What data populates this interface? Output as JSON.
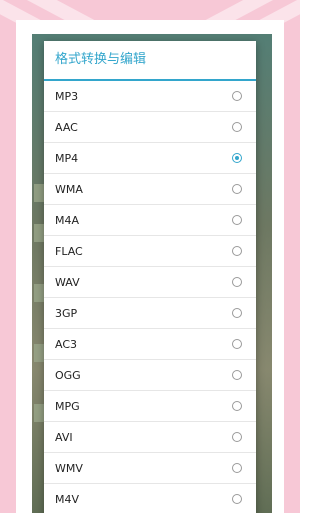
{
  "dialog": {
    "title": "格式转换与编辑",
    "selected": "MP4",
    "options": [
      {
        "label": "MP3",
        "checked": false
      },
      {
        "label": "AAC",
        "checked": false
      },
      {
        "label": "MP4",
        "checked": true
      },
      {
        "label": "WMA",
        "checked": false
      },
      {
        "label": "M4A",
        "checked": false
      },
      {
        "label": "FLAC",
        "checked": false
      },
      {
        "label": "WAV",
        "checked": false
      },
      {
        "label": "3GP",
        "checked": false
      },
      {
        "label": "AC3",
        "checked": false
      },
      {
        "label": "OGG",
        "checked": false
      },
      {
        "label": "MPG",
        "checked": false
      },
      {
        "label": "AVI",
        "checked": false
      },
      {
        "label": "WMV",
        "checked": false
      },
      {
        "label": "M4V",
        "checked": false
      }
    ]
  },
  "colors": {
    "accent": "#33a6cc",
    "frame": "#f7c8d6"
  }
}
